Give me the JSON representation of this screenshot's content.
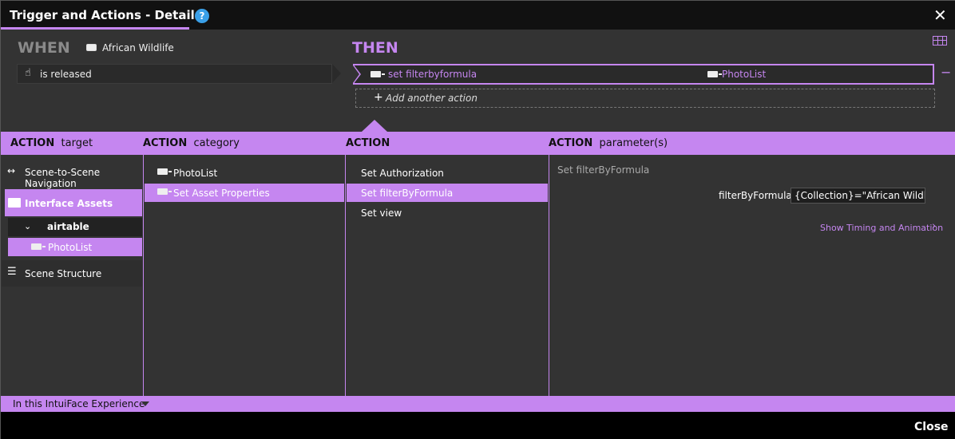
{
  "window": {
    "title": "Trigger and Actions - Details",
    "help_glyph": "?",
    "close_glyph": "✕"
  },
  "when": {
    "heading": "WHEN",
    "source_name": "African Wildlife",
    "trigger_label": "is released"
  },
  "then": {
    "heading": "THEN",
    "action_label": "set filterbyformula",
    "action_target": "PhotoList",
    "remove_glyph": "−",
    "add_label": "Add another action",
    "add_glyph": "+"
  },
  "columns": {
    "target": {
      "bold": "ACTION",
      "rest": "target"
    },
    "category": {
      "bold": "ACTION",
      "rest": "category"
    },
    "action": {
      "bold": "ACTION",
      "rest": ""
    },
    "params": {
      "bold": "ACTION",
      "rest": "parameter(s)"
    }
  },
  "target_list": {
    "nav": "Scene-to-Scene Navigation",
    "assets": "Interface Assets",
    "airtable": "airtable",
    "photolist": "PhotoList",
    "structure": "Scene Structure"
  },
  "category_list": [
    "PhotoList",
    "Set Asset Properties"
  ],
  "action_list": [
    "Set Authorization",
    "Set filterByFormula",
    "Set view"
  ],
  "params": {
    "title": "Set filterByFormula",
    "param_label": "filterByFormula",
    "param_value": "{Collection}=\"African Wildlife\"",
    "timing_link": "Show Timing and Animation"
  },
  "footer": {
    "scope": "In this IntuiFace Experience",
    "close": "Close"
  },
  "colors": {
    "accent": "#c586f0",
    "help": "#3aa0e8",
    "bg": "#333333",
    "titlebar": "#111111"
  }
}
